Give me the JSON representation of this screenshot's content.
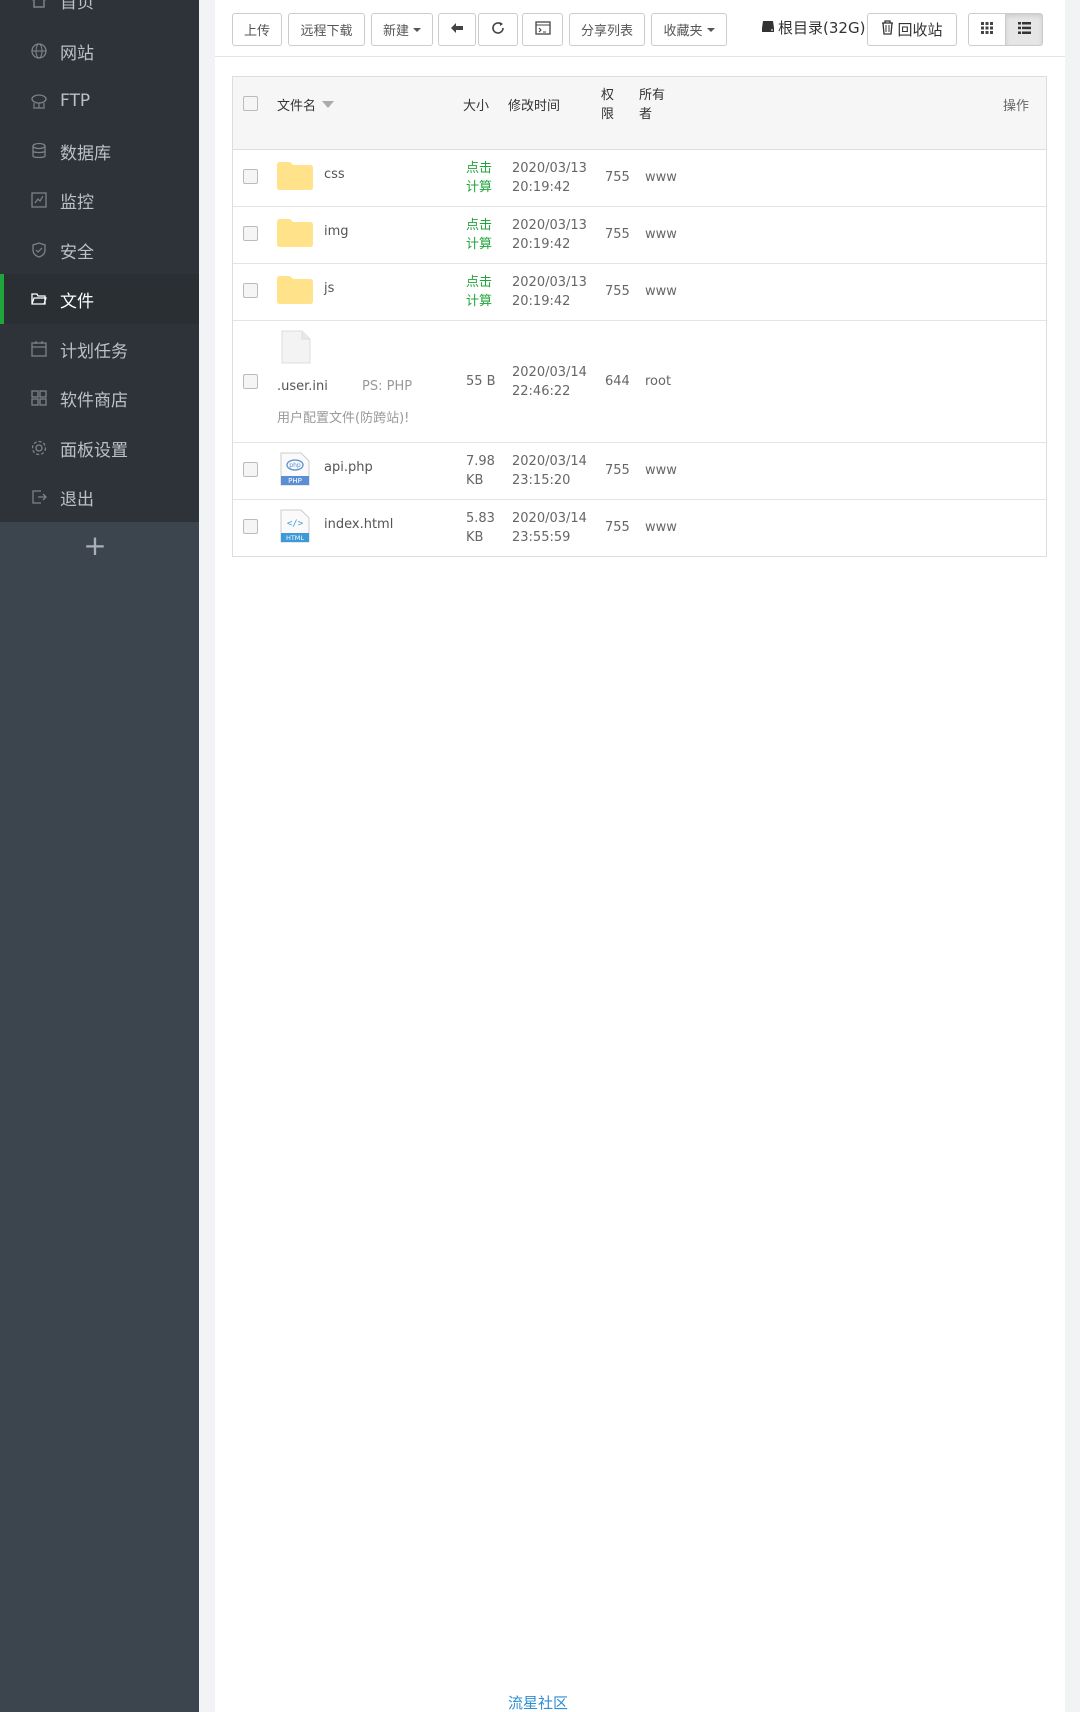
{
  "sidebar": {
    "items": [
      {
        "label": "首页",
        "icon": "home-icon"
      },
      {
        "label": "网站",
        "icon": "globe-icon"
      },
      {
        "label": "FTP",
        "icon": "ftp-icon"
      },
      {
        "label": "数据库",
        "icon": "database-icon"
      },
      {
        "label": "监控",
        "icon": "monitor-icon"
      },
      {
        "label": "安全",
        "icon": "shield-icon"
      },
      {
        "label": "文件",
        "icon": "folder-open-icon",
        "active": true
      },
      {
        "label": "计划任务",
        "icon": "calendar-icon"
      },
      {
        "label": "软件商店",
        "icon": "apps-icon"
      },
      {
        "label": "面板设置",
        "icon": "gear-icon"
      },
      {
        "label": "退出",
        "icon": "logout-icon"
      }
    ],
    "add_label": "+"
  },
  "toolbar": {
    "upload": "上传",
    "remote_download": "远程下载",
    "new": "新建",
    "share_list": "分享列表",
    "favorites": "收藏夹",
    "disk": "根目录(32G)",
    "recycle": "回收站"
  },
  "table": {
    "headers": {
      "name": "文件名",
      "size": "大小",
      "mtime": "修改时间",
      "perm": "权限",
      "owner": "所有者",
      "ops": "操作"
    },
    "rows": [
      {
        "name": "css",
        "type": "folder",
        "size": "点击计算",
        "date": "2020/03/13",
        "time": "20:19:42",
        "perm": "755",
        "owner": "www"
      },
      {
        "name": "img",
        "type": "folder",
        "size": "点击计算",
        "date": "2020/03/13",
        "time": "20:19:42",
        "perm": "755",
        "owner": "www"
      },
      {
        "name": "js",
        "type": "folder",
        "size": "点击计算",
        "date": "2020/03/13",
        "time": "20:19:42",
        "perm": "755",
        "owner": "www"
      },
      {
        "name": ".user.ini",
        "type": "file",
        "note": "PS: PHP用户配置文件(防跨站)!",
        "size": "55 B",
        "date": "2020/03/14",
        "time": "22:46:22",
        "perm": "644",
        "owner": "root"
      },
      {
        "name": "api.php",
        "type": "php",
        "size": "7.98 KB",
        "date": "2020/03/14",
        "time": "23:15:20",
        "perm": "755",
        "owner": "www"
      },
      {
        "name": "index.html",
        "type": "html",
        "size": "5.83 KB",
        "date": "2020/03/14",
        "time": "23:55:59",
        "perm": "755",
        "owner": "www"
      }
    ]
  },
  "footer": {
    "link": "流星社区"
  },
  "colors": {
    "accent": "#20a53a",
    "sidebar": "#3c444d",
    "link": "#2e8ed6",
    "folder": "#ffe289"
  }
}
